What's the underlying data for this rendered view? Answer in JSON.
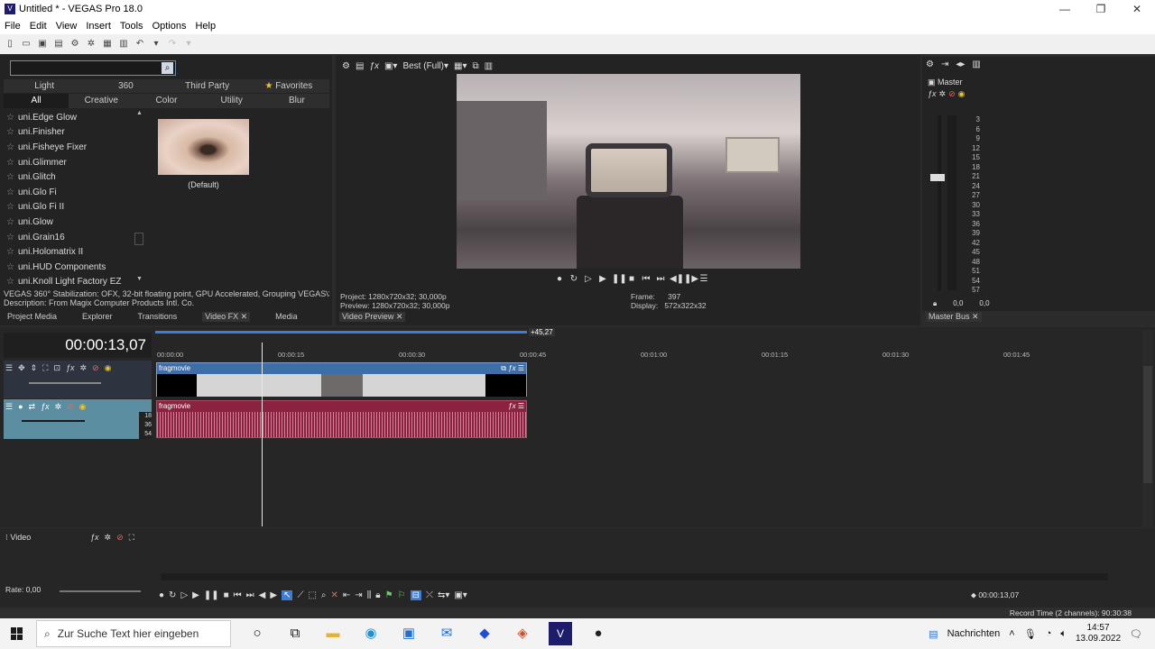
{
  "window": {
    "title": "Untitled * - VEGAS Pro 18.0",
    "app_icon": "V",
    "min": "—",
    "max": "❐",
    "close": "✕"
  },
  "menu": [
    "File",
    "Edit",
    "View",
    "Insert",
    "Tools",
    "Options",
    "Help"
  ],
  "fx_panel": {
    "search_placeholder": "",
    "tabs_row1": [
      "Light",
      "360",
      "Third Party",
      "Favorites"
    ],
    "tabs_row2": [
      "All",
      "Creative",
      "Color",
      "Utility",
      "Blur"
    ],
    "active_tab": "All",
    "items": [
      "uni.Edge Glow",
      "uni.Finisher",
      "uni.Fisheye Fixer",
      "uni.Glimmer",
      "uni.Glitch",
      "uni.Glo Fi",
      "uni.Glo Fi II",
      "uni.Glow",
      "uni.Grain16",
      "uni.Holomatrix II",
      "uni.HUD Components",
      "uni.Knoll Light Factory EZ"
    ],
    "preset_label": "(Default)",
    "description_line1": "VEGAS 360° Stabilization: OFX, 32-bit floating point, GPU Accelerated, Grouping VEGAS\\360",
    "description_line2": "Description: From Magix Computer Products Intl. Co."
  },
  "left_dock_tabs": [
    "Project Media",
    "Explorer",
    "Transitions",
    "Video FX",
    "Media"
  ],
  "preview": {
    "quality": "Best (Full)",
    "project": "Project:  1280x720x32; 30,000p",
    "preview": "Preview:  1280x720x32; 30,000p",
    "frame_label": "Frame:",
    "frame_value": "397",
    "display_label": "Display:",
    "display_value": "572x322x32",
    "tab": "Video Preview"
  },
  "mixer": {
    "title": "Master",
    "scale": [
      "3",
      "6",
      "9",
      "12",
      "15",
      "18",
      "21",
      "24",
      "27",
      "30",
      "33",
      "36",
      "39",
      "42",
      "45",
      "48",
      "51",
      "54",
      "57"
    ],
    "left_value": "0,0",
    "right_value": "0,0",
    "tab": "Master Bus"
  },
  "timeline": {
    "timecode": "00:00:13,07",
    "region_end": "+45,27",
    "ruler": [
      "00:00:00",
      "00:00:15",
      "00:00:30",
      "00:00:45",
      "00:01:00",
      "00:01:15",
      "00:01:30",
      "00:01:45"
    ],
    "video_clip": "fragmovie",
    "audio_clip": "fragmovie",
    "audio_levels": [
      "18",
      "36",
      "54"
    ],
    "video_bus": "Video",
    "rate": "Rate: 0,00"
  },
  "bottom": {
    "cursor_time": "00:00:13,07",
    "record_time": "Record Time (2 channels): 90:30:38"
  },
  "taskbar": {
    "search": "Zur Suche Text hier eingeben",
    "news": "Nachrichten",
    "time": "14:57",
    "date": "13.09.2022"
  }
}
